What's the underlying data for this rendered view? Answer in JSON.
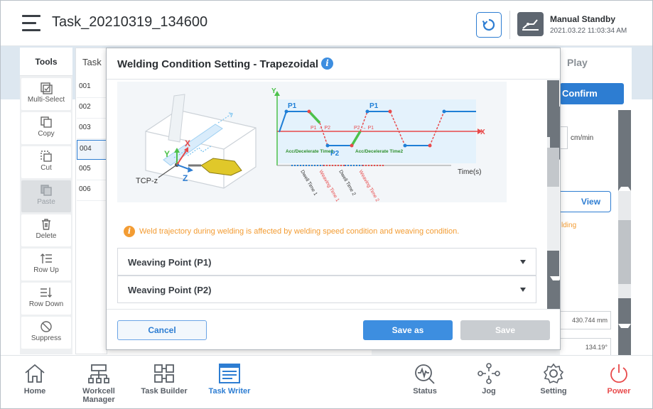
{
  "header": {
    "task_title": "Task_20210319_134600",
    "robot_mode": "Manual Standby",
    "timestamp": "2021.03.22 11:03:34 AM"
  },
  "tools": {
    "title": "Tools",
    "items": [
      {
        "label": "Multi-Select",
        "icon": "multi-select-icon",
        "enabled": true
      },
      {
        "label": "Copy",
        "icon": "copy-icon",
        "enabled": true
      },
      {
        "label": "Cut",
        "icon": "cut-icon",
        "enabled": true
      },
      {
        "label": "Paste",
        "icon": "paste-icon",
        "enabled": false
      },
      {
        "label": "Delete",
        "icon": "trash-icon",
        "enabled": true
      },
      {
        "label": "Row Up",
        "icon": "row-up-icon",
        "enabled": true
      },
      {
        "label": "Row Down",
        "icon": "row-down-icon",
        "enabled": true
      },
      {
        "label": "Suppress",
        "icon": "suppress-icon",
        "enabled": true
      }
    ]
  },
  "steps": {
    "header": "Task",
    "rows": [
      "001",
      "002",
      "003",
      "004",
      "005",
      "006"
    ],
    "selected": "004"
  },
  "right_panel": {
    "play_tab": "Play",
    "confirm_label": "Confirm",
    "unit": "cm/min",
    "view_label": "View",
    "partial_text": "lding",
    "value1": "430.744 mm",
    "value2": "134.19°"
  },
  "modal": {
    "title": "Welding Condition Setting - Trapezoidal",
    "diagram": {
      "tcp_label": "TCP-z",
      "axis_x": "X",
      "axis_y": "Y",
      "axis_z": "Z",
      "p1": "P1",
      "p2": "P2",
      "arrow_p1_p2": "P1 → P2",
      "arrow_p2_p1": "P2 → P1",
      "acc_time1": "Acc/Decelerate Time1",
      "acc_time2": "Acc/Decelerate Time2",
      "dwell1": "Dwell Time 1",
      "weaving1": "Weaving Time 1",
      "dwell2": "Dwell Time 2",
      "weaving2": "Weaving Time 2",
      "time_label": "Time(s)"
    },
    "notice": "Weld trajectory during welding is affected by welding speed condition and weaving condition.",
    "sections": [
      "Weaving Point (P1)",
      "Weaving Point (P2)"
    ],
    "cancel_label": "Cancel",
    "save_as_label": "Save as",
    "save_label": "Save"
  },
  "bottom_nav": [
    {
      "label": "Home",
      "icon": "home-icon"
    },
    {
      "label": "Workcell Manager",
      "icon": "workcell-icon"
    },
    {
      "label": "Task Builder",
      "icon": "task-builder-icon"
    },
    {
      "label": "Task Writer",
      "icon": "task-writer-icon",
      "active": true
    },
    {
      "label": "Status",
      "icon": "status-icon"
    },
    {
      "label": "Jog",
      "icon": "jog-icon"
    },
    {
      "label": "Setting",
      "icon": "gear-icon"
    },
    {
      "label": "Power",
      "icon": "power-icon"
    }
  ],
  "colors": {
    "accent": "#2d7dd2",
    "warning": "#f39c33",
    "power": "#e8494a",
    "diagram_green": "#4cc14a",
    "diagram_red": "#e8494a"
  }
}
